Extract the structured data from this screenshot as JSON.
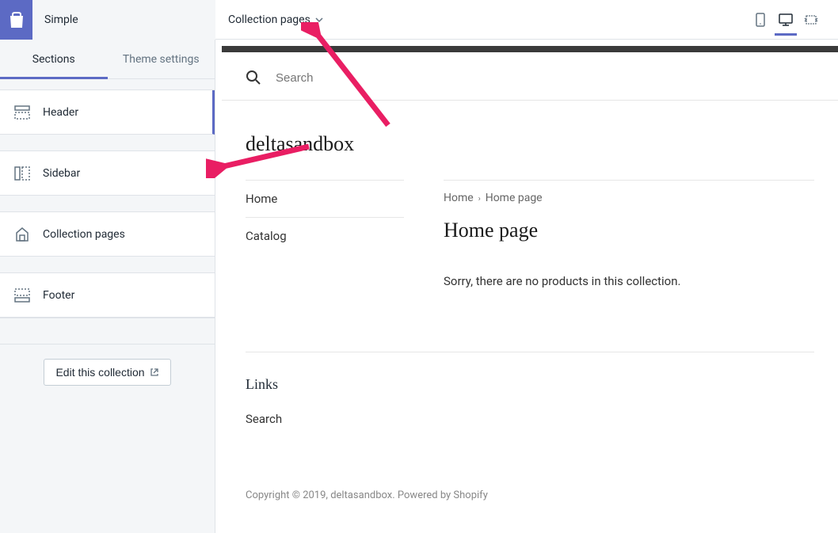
{
  "topbar": {
    "theme_name": "Simple",
    "page_selector": "Collection pages"
  },
  "tabs": {
    "sections": "Sections",
    "theme_settings": "Theme settings"
  },
  "sections": {
    "header": "Header",
    "sidebar": "Sidebar",
    "collection_pages": "Collection pages",
    "footer": "Footer"
  },
  "actions": {
    "edit_collection": "Edit this collection"
  },
  "preview": {
    "search_placeholder": "Search",
    "site_title": "deltasandbox",
    "nav": {
      "home": "Home",
      "catalog": "Catalog"
    },
    "breadcrumb": {
      "home": "Home",
      "current": "Home page"
    },
    "page_title": "Home page",
    "empty_message": "Sorry, there are no products in this collection.",
    "footer": {
      "heading": "Links",
      "search": "Search"
    },
    "copyright": "Copyright © 2019, deltasandbox. Powered by Shopify"
  }
}
